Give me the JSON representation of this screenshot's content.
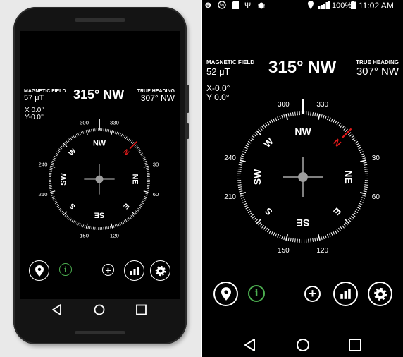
{
  "status_bar": {
    "battery": "100%",
    "time": "11:02 AM",
    "icons": [
      "target-icon",
      "percent-icon",
      "sd-card-icon",
      "usb-icon",
      "android-bug-icon",
      "location-icon",
      "signal-icon",
      "battery-icon"
    ]
  },
  "compass": {
    "magnetic_label": "MAGNETIC FIELD",
    "heading_label": "TRUE HEADING",
    "left": {
      "magnetic_value": "57 μT",
      "heading_main": "315° NW",
      "true_heading": "307° NW",
      "x_line": "X  0.0°",
      "y_line": "Y-0.0°"
    },
    "right": {
      "magnetic_value": "52 μT",
      "heading_main": "315° NW",
      "true_heading": "307° NW",
      "x_line": "X-0.0°",
      "y_line": "Y  0.0°"
    },
    "rotation_deg": 315,
    "cardinals": [
      "N",
      "E",
      "S",
      "W"
    ],
    "intercardinals": [
      "NE",
      "SE",
      "SW",
      "NW"
    ],
    "degree_labels": [
      "30",
      "60",
      "120",
      "150",
      "210",
      "240",
      "300",
      "330"
    ],
    "north_color": "#e21b1b"
  },
  "controls": {
    "icons": [
      "location-pin-icon",
      "info-icon",
      "add-icon",
      "bar-chart-icon",
      "gear-icon"
    ],
    "info_glyph": "i",
    "plus_glyph": "+",
    "accent": "#4caf50"
  },
  "nav": {
    "icons": [
      "back-icon",
      "home-icon",
      "recents-icon"
    ]
  }
}
